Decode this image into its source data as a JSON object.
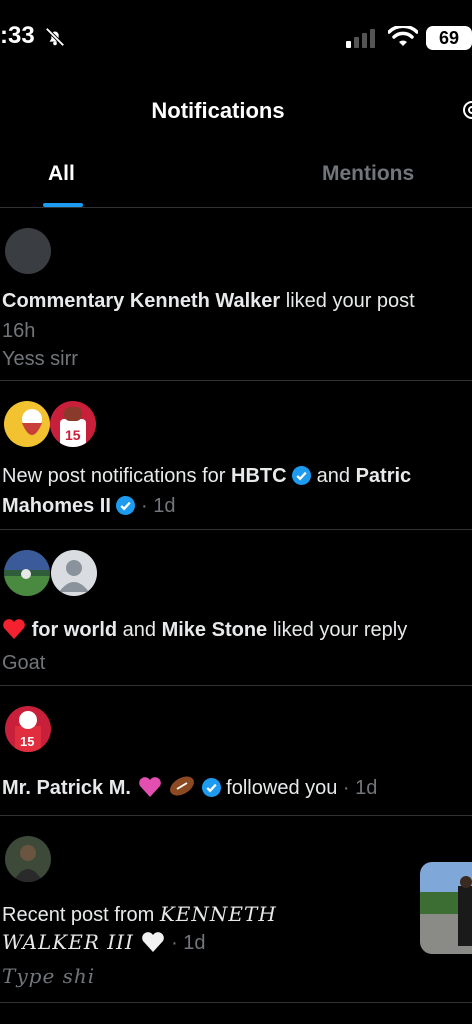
{
  "status_bar": {
    "time": ":33",
    "battery": "69"
  },
  "header": {
    "title": "Notifications"
  },
  "tabs": [
    {
      "label": "All",
      "active": true
    },
    {
      "label": "Mentions",
      "active": false
    }
  ],
  "notifications": [
    {
      "name": "Commentary Kenneth Walker",
      "action": " liked your post",
      "time": "16h",
      "snippet": "Yess sirr"
    },
    {
      "prefix": "New post notifications for ",
      "name1": "HBTC",
      "middle": " and ",
      "name2_part1": "Patric",
      "name2_part2": "Mahomes II",
      "time": " · 1d"
    },
    {
      "name1": "for world",
      "middle": " and ",
      "name2": "Mike Stone",
      "action": " liked your reply",
      "snippet": "Goat"
    },
    {
      "name": "Mr. Patrick M.",
      "action": " followed you",
      "time": " · 1d"
    },
    {
      "prefix": "Recent post from ",
      "name_part1": "KENNETH",
      "name_part2": "WALKER III",
      "time": " · 1d",
      "snippet": "Type shi"
    }
  ],
  "colors": {
    "accent": "#1d9bf0",
    "background": "#000000",
    "muted": "#71767b",
    "heart": "#f4212e"
  }
}
